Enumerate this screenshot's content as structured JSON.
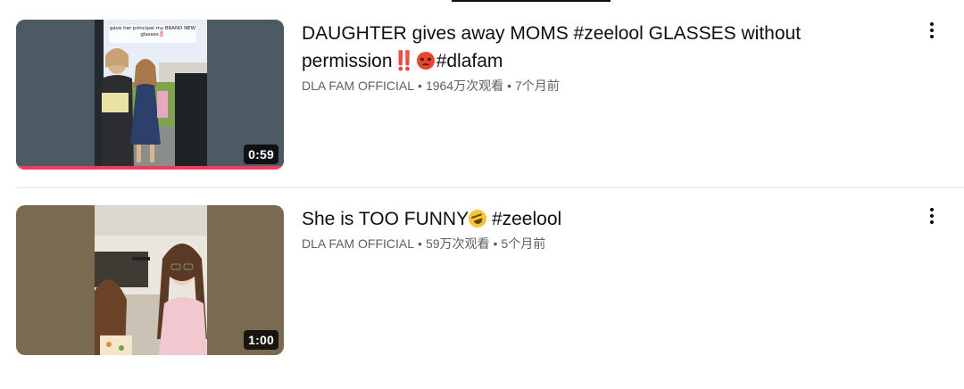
{
  "results": [
    {
      "title_parts": [
        "DAUGHTER gives away MOMS #zeelool GLASSES without permission",
        "‼️",
        "#dlafam"
      ],
      "channel": "DLA FAM OFFICIAL",
      "separator": "•",
      "views": "1964万次观看",
      "age": "7个月前",
      "duration": "0:59",
      "thumbnail_caption": "gave her principal my BRAND NEW glasses‼️",
      "watch_progress": 1.0,
      "icons": [
        "double-exclamation-icon",
        "angry-face-icon",
        "more-vert-icon"
      ]
    },
    {
      "title_parts": [
        "She is TOO FUNNY",
        "#zeelool"
      ],
      "channel": "DLA FAM OFFICIAL",
      "separator": "•",
      "views": "59万次观看",
      "age": "5个月前",
      "duration": "1:00",
      "icons": [
        "rolling-laughing-face-icon",
        "more-vert-icon"
      ]
    }
  ],
  "colors": {
    "progress": "#f03a5f",
    "title_text": "#0f0f0f",
    "meta_text": "#606060"
  }
}
